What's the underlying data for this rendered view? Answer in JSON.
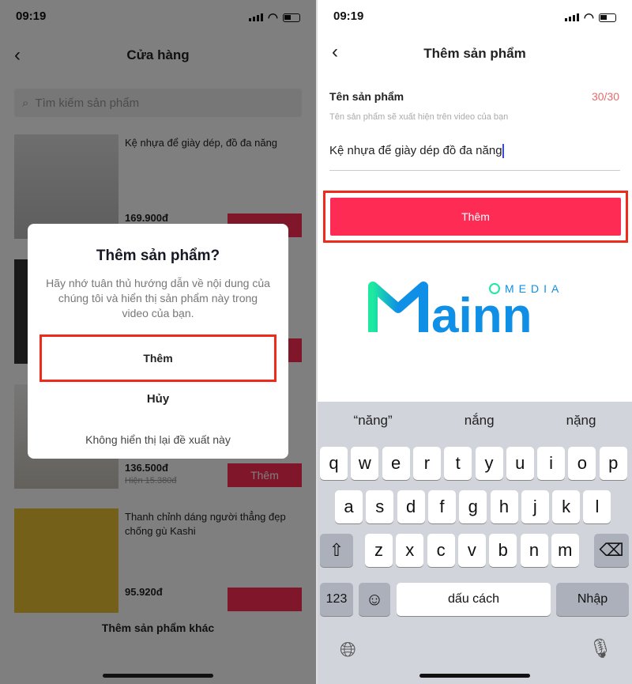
{
  "status": {
    "time": "09:19"
  },
  "left": {
    "title": "Cửa hàng",
    "search_placeholder": "Tìm kiếm sản phẩm",
    "products": [
      {
        "name": "Kệ nhựa để giày dép, đồ đa năng",
        "price": "169.900đ",
        "button": ""
      },
      {
        "name": "",
        "price": "",
        "button": ""
      },
      {
        "name": "",
        "price": "136.500đ",
        "sub": "Hiện 15.380đ",
        "button": "Thêm"
      },
      {
        "name": "Thanh chỉnh dáng người thẳng đẹp chống gù Kashi",
        "price": "95.920đ",
        "button": ""
      }
    ],
    "more": "Thêm sản phẩm khác",
    "dialog": {
      "title": "Thêm sản phẩm?",
      "body": "Hãy nhớ tuân thủ hướng dẫn về nội dung của chúng tôi và hiển thị sản phẩm này trong video của bạn.",
      "confirm": "Thêm",
      "cancel": "Hủy",
      "dismiss": "Không hiển thị lại đề xuất này"
    }
  },
  "right": {
    "title": "Thêm sản phẩm",
    "field_label": "Tên sản phẩm",
    "counter": "30/30",
    "hint": "Tên sản phẩm sẽ xuất hiện trên video của bạn",
    "input_value": "Kệ nhựa để giày dép đồ đa năng",
    "add_button": "Thêm",
    "watermark": "Mainn MEDIA",
    "keyboard": {
      "suggestions": [
        "“năng”",
        "nắng",
        "nặng"
      ],
      "row1": [
        "q",
        "w",
        "e",
        "r",
        "t",
        "y",
        "u",
        "i",
        "o",
        "p"
      ],
      "row2": [
        "a",
        "s",
        "d",
        "f",
        "g",
        "h",
        "j",
        "k",
        "l"
      ],
      "row3": [
        "z",
        "x",
        "c",
        "v",
        "b",
        "n",
        "m"
      ],
      "numbers": "123",
      "space": "dấu cách",
      "return": "Nhập"
    }
  },
  "colors": {
    "accent": "#fe2c55",
    "highlight": "#ee2a1b",
    "logo_green": "#1de9a0",
    "logo_blue": "#0f8fe6"
  }
}
